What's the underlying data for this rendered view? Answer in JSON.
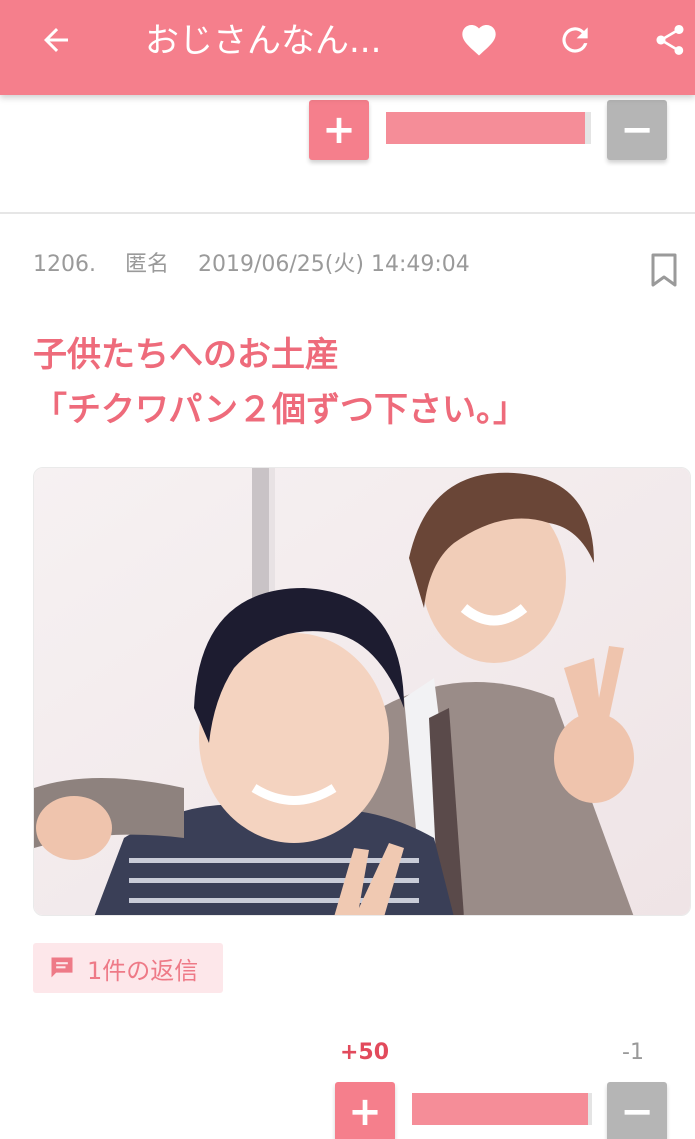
{
  "header": {
    "title": "おじさんなん...",
    "back_icon": "arrow-left-icon",
    "favorite_icon": "heart-icon",
    "reload_icon": "refresh-icon",
    "share_icon": "share-icon",
    "bar_color": "#f57f8c"
  },
  "top_vote": {
    "plus_label": "+",
    "minus_label": "−",
    "plus_ratio": 0.97
  },
  "comment": {
    "number": "1206.",
    "author": "匿名",
    "datetime": "2019/06/25(火) 14:49:04",
    "body": "子供たちへのお土産\n「チクワパン２個ずつ下さい。」",
    "image_alt": "two men smiling, one making peace sign",
    "reply_label": "1件の返信",
    "vote": {
      "plus_score": "+50",
      "minus_score": "-1",
      "plus_label": "+",
      "minus_label": "−",
      "plus_ratio": 0.98
    }
  },
  "colors": {
    "accent": "#f57f8c",
    "body_text": "#ee6b7b",
    "meta_text": "#9a9a9a",
    "minus_button": "#b5b5b5",
    "reply_bg": "#fde7ea"
  }
}
